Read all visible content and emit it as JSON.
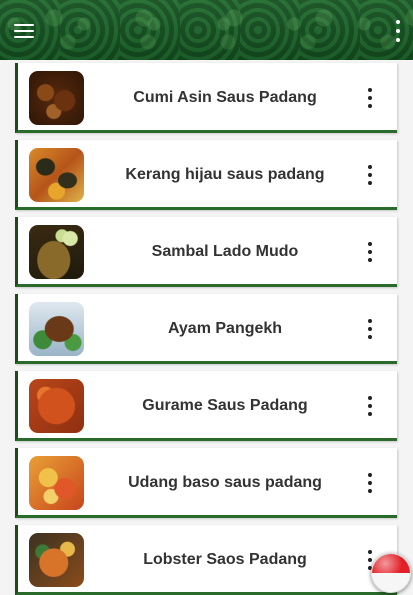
{
  "appbar": {
    "menu_icon": "hamburger-menu-icon",
    "overflow_icon": "more-vert-icon",
    "color": "#155523"
  },
  "recipes": [
    {
      "title": "Cumi Asin Saus Padang"
    },
    {
      "title": "Kerang hijau saus padang"
    },
    {
      "title": "Sambal Lado Mudo"
    },
    {
      "title": "Ayam Pangekh"
    },
    {
      "title": "Gurame Saus Padang"
    },
    {
      "title": "Udang baso saus padang"
    },
    {
      "title": "Lobster Saos Padang"
    }
  ],
  "colors": {
    "card_accent": "#1b4d1b",
    "title_text": "#333333",
    "flag_red": "#e21f26",
    "flag_white": "#f6f6f6"
  },
  "language_button": {
    "icon": "indonesia-flag-icon"
  }
}
